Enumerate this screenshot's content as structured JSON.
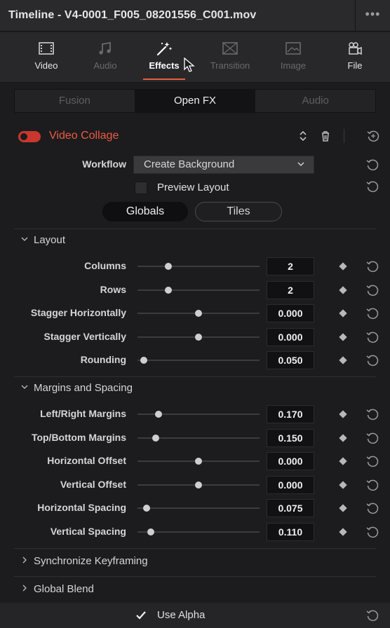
{
  "window": {
    "title": "Timeline - V4-0001_F005_08201556_C001.mov",
    "more_glyph": "•••"
  },
  "inspector_tabs": [
    {
      "label": "Video",
      "icon": "film-icon",
      "state": "normal"
    },
    {
      "label": "Audio",
      "icon": "music-note-icon",
      "state": "disabled"
    },
    {
      "label": "Effects",
      "icon": "magic-wand-icon",
      "state": "active"
    },
    {
      "label": "Transition",
      "icon": "transition-icon",
      "state": "disabled"
    },
    {
      "label": "Image",
      "icon": "image-icon",
      "state": "disabled"
    },
    {
      "label": "File",
      "icon": "file-camera-icon",
      "state": "normal"
    }
  ],
  "subtabs": [
    {
      "label": "Fusion",
      "active": false
    },
    {
      "label": "Open FX",
      "active": true
    },
    {
      "label": "Audio",
      "active": false
    }
  ],
  "effect": {
    "name": "Video Collage",
    "enabled": true,
    "accent_color": "#ee5a43",
    "workflow_label": "Workflow",
    "workflow_value": "Create Background",
    "preview_layout_label": "Preview Layout",
    "preview_layout_checked": false,
    "modes": [
      {
        "label": "Globals",
        "active": true
      },
      {
        "label": "Tiles",
        "active": false
      }
    ]
  },
  "layout_section": {
    "title": "Layout",
    "expanded": true,
    "params": [
      {
        "label": "Columns",
        "value": "2",
        "slider": 0.25
      },
      {
        "label": "Rows",
        "value": "2",
        "slider": 0.25
      },
      {
        "label": "Stagger Horizontally",
        "value": "0.000",
        "slider": 0.5
      },
      {
        "label": "Stagger Vertically",
        "value": "0.000",
        "slider": 0.5
      },
      {
        "label": "Rounding",
        "value": "0.050",
        "slider": 0.05
      }
    ]
  },
  "margins_section": {
    "title": "Margins and Spacing",
    "expanded": true,
    "params": [
      {
        "label": "Left/Right Margins",
        "value": "0.170",
        "slider": 0.17
      },
      {
        "label": "Top/Bottom Margins",
        "value": "0.150",
        "slider": 0.15
      },
      {
        "label": "Horizontal Offset",
        "value": "0.000",
        "slider": 0.5
      },
      {
        "label": "Vertical Offset",
        "value": "0.000",
        "slider": 0.5
      },
      {
        "label": "Horizontal Spacing",
        "value": "0.075",
        "slider": 0.075
      },
      {
        "label": "Vertical Spacing",
        "value": "0.110",
        "slider": 0.11
      }
    ]
  },
  "collapsed_sections": [
    {
      "title": "Synchronize Keyframing"
    },
    {
      "title": "Global Blend"
    }
  ],
  "footer": {
    "use_alpha_label": "Use Alpha",
    "use_alpha_checked": true
  }
}
